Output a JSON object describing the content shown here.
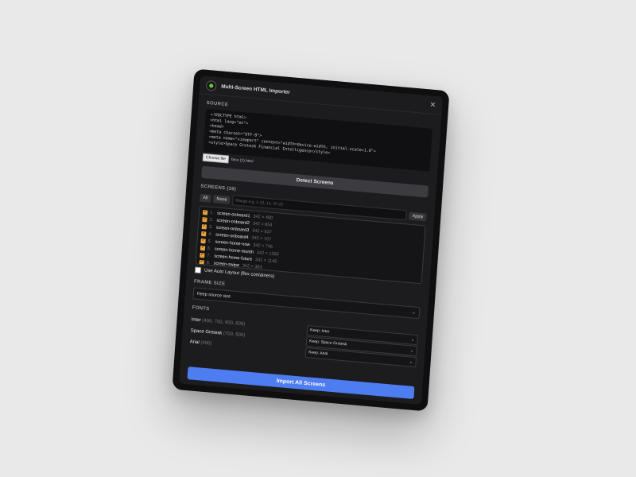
{
  "window": {
    "title": "Multi-Screen HTML Importer"
  },
  "source": {
    "label": "SOURCE",
    "code_lines": [
      "<!DOCTYPE html>",
      "<html lang=\"en\">",
      "<head>",
      "<meta charset=\"UTF-8\">",
      "<meta name=\"viewport\" content=\"width=device-width, initial-scale=1.0\">",
      "<style>Space Grotesk Financial Intelligence</style>"
    ],
    "file_button": "Choose file",
    "file_name": "face (1).html"
  },
  "detect_button": "Detect Screens",
  "screens": {
    "label": "SCREENS (39)",
    "all_button": "All",
    "none_button": "None",
    "range_placeholder": "Range e.g. 1-10, 14, 20-25",
    "apply_button": "Apply",
    "items": [
      {
        "num": "1.",
        "name": "screen-onboard1",
        "size": "342 × 480"
      },
      {
        "num": "2.",
        "name": "screen-onboard2",
        "size": "342 × 854"
      },
      {
        "num": "3.",
        "name": "screen-onboard3",
        "size": "342 × 837"
      },
      {
        "num": "4.",
        "name": "screen-onboard4",
        "size": "342 × 707"
      },
      {
        "num": "5.",
        "name": "screen-home-now",
        "size": "342 × 746"
      },
      {
        "num": "6.",
        "name": "screen-home-month",
        "size": "342 × 1260"
      },
      {
        "num": "7.",
        "name": "screen-home-future",
        "size": "342 × 1145"
      },
      {
        "num": "8.",
        "name": "screen-swipe",
        "size": "342 × 383"
      }
    ]
  },
  "auto_layout": {
    "label": "Use Auto Layout (flex containers)"
  },
  "frame_size": {
    "label": "FRAME SIZE",
    "value": "Keep source size"
  },
  "fonts": {
    "label": "FONTS",
    "items": [
      {
        "name": "Inter",
        "weights": "(400, 700, 900, 600)",
        "value": "Keep: Inter"
      },
      {
        "name": "Space Grotesk",
        "weights": "(700, 600)",
        "value": "Keep: Space Grotesk"
      },
      {
        "name": "Arial",
        "weights": "(400)",
        "value": "Keep: Arial"
      }
    ]
  },
  "import_button": "Import All Screens",
  "colors": {
    "accent": "#4d7df0",
    "checkbox": "#e8a13a",
    "panel": "#1c1c1e"
  },
  "icons": {
    "logo": "app-logo-icon",
    "close": "close-icon",
    "chevron": "chevron-down-icon"
  }
}
